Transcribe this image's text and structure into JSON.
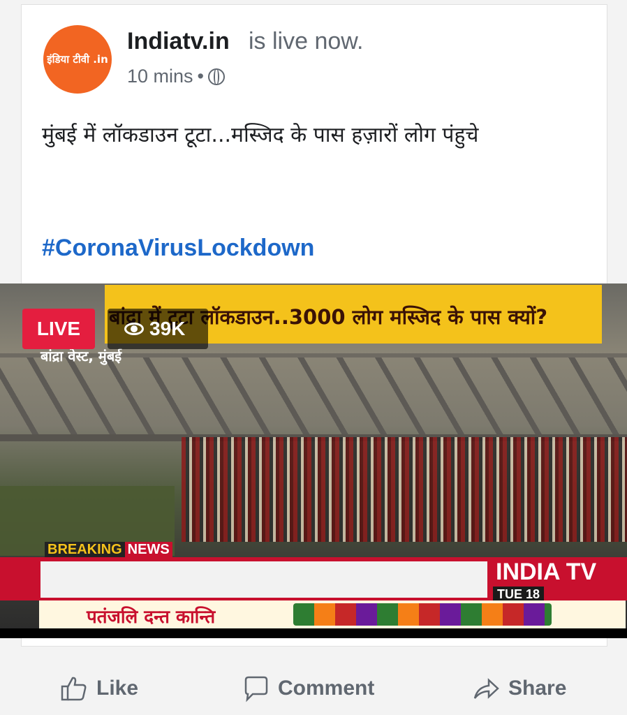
{
  "post": {
    "avatar_label": "इंडिया टीवी .in",
    "page_name": "Indiatv.in",
    "status": "is live now.",
    "time": "10 mins",
    "separator": "•",
    "text": "मुंबई में लॉकडाउन टूटा...मस्जिद के पास हज़ारों  लोग पंहुचे",
    "hashtag": "#CoronaVirusLockdown"
  },
  "video": {
    "live_label": "LIVE",
    "views": "39K",
    "headline": "बांद्रा में टूटा लॉकडाउन..3000 लोग मस्जिद के पास क्यों?",
    "location": "बांद्रा वेस्ट, मुंबई",
    "breaking_1": "BREAKING",
    "breaking_2": "NEWS",
    "channel_logo": "INDIA TV",
    "date": "TUE 18",
    "ad_text": "पतंजलि दन्त कान्ति"
  },
  "actions": {
    "like": "Like",
    "comment": "Comment",
    "share": "Share"
  },
  "colors": {
    "brand_orange": "#f26522",
    "link_blue": "#1d68c9",
    "live_red": "#e41e3f",
    "headline_yellow": "#f4c21b"
  }
}
